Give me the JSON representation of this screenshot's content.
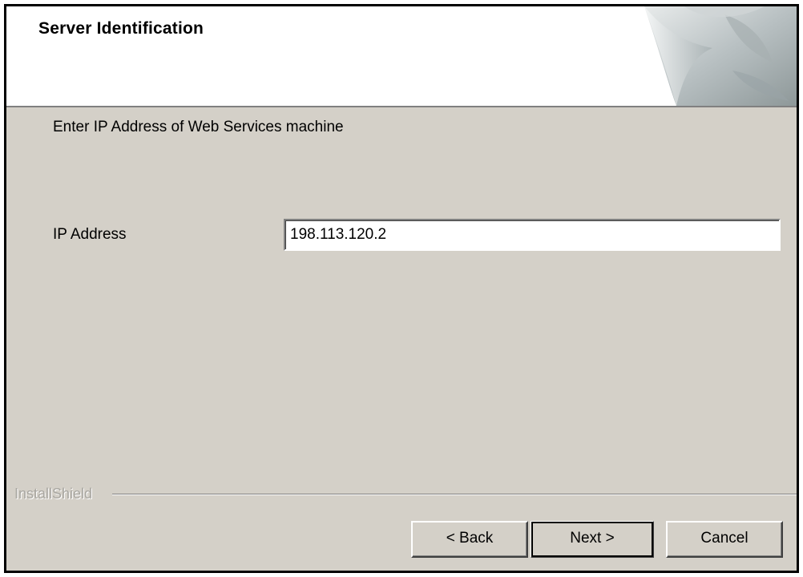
{
  "header": {
    "title": "Server Identification",
    "graphic_icon": "page-curl-icon"
  },
  "body": {
    "instruction": "Enter IP Address of Web Services machine",
    "ip_label": "IP Address",
    "ip_value": "198.113.120.2"
  },
  "footer": {
    "brand": "InstallShield",
    "back_label": "< Back",
    "next_label": "Next >",
    "cancel_label": "Cancel"
  },
  "colors": {
    "dialog_bg": "#d4d0c8",
    "header_bg": "#ffffff",
    "brand_text": "#a8a6a0"
  }
}
